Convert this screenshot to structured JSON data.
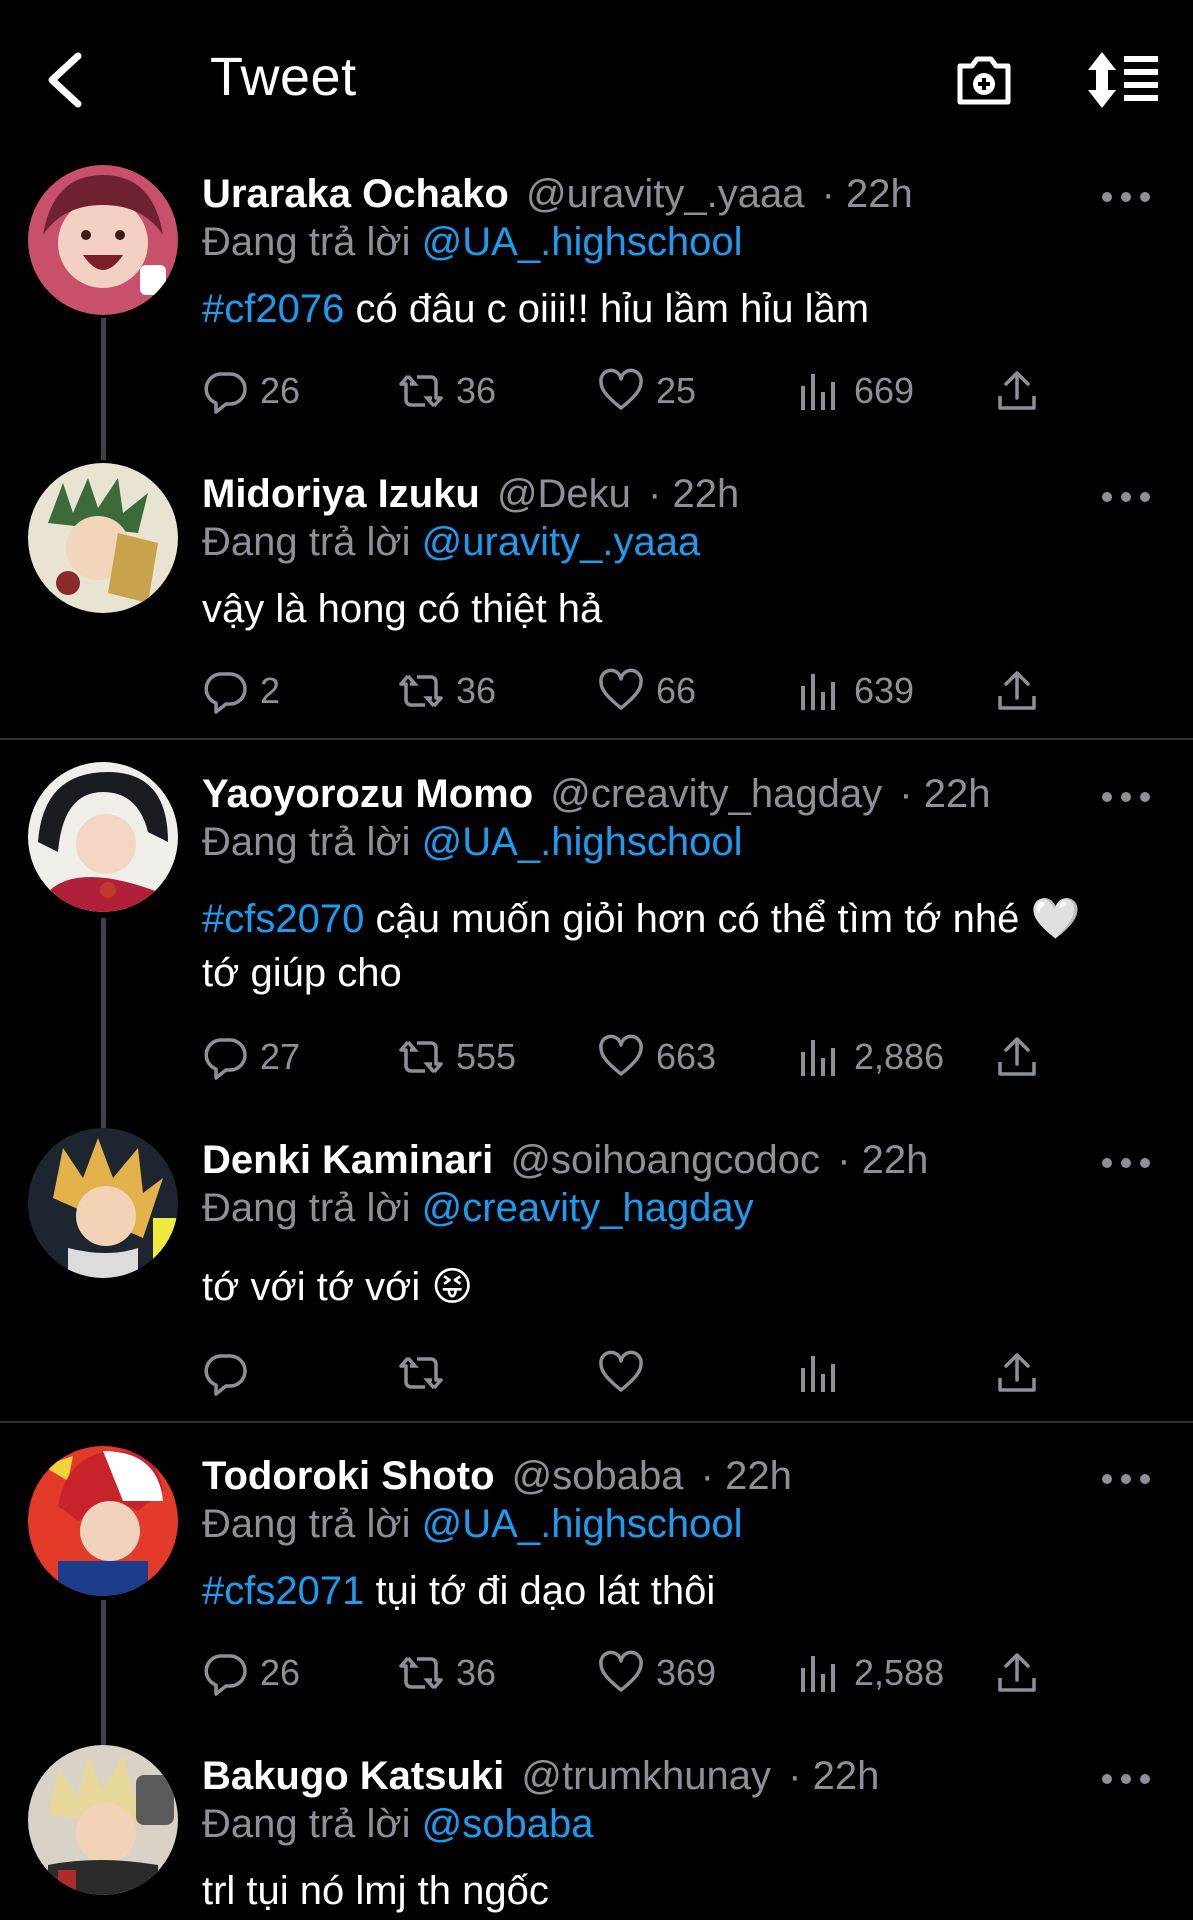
{
  "header": {
    "title": "Tweet"
  },
  "tweets": [
    {
      "name": "Uraraka Ochako",
      "handle": "@uravity_.yaaa",
      "time": "· 22h",
      "reply_prefix": "Đang trả lời",
      "reply_to": "@UA_.highschool",
      "tag": "#cf2076",
      "text": " có đâu c oiii!! hỉu lầm hỉu lầm",
      "replies": "26",
      "retweets": "36",
      "likes": "25",
      "views": "669"
    },
    {
      "name": "Midoriya Izuku",
      "handle": "@Deku",
      "time": "· 22h",
      "reply_prefix": "Đang trả lời",
      "reply_to": "@uravity_.yaaa",
      "tag": "",
      "text": "vậy là hong có thiệt hả",
      "replies": "2",
      "retweets": "36",
      "likes": "66",
      "views": "639"
    },
    {
      "name": "Yaoyorozu Momo",
      "handle": "@creavity_hagday",
      "time": "· 22h",
      "reply_prefix": "Đang trả lời",
      "reply_to": "@UA_.highschool",
      "tag": "#cfs2070",
      "text": " cậu muốn giỏi hơn có thể tìm tớ nhé 🤍",
      "text2": "tớ giúp cho",
      "replies": "27",
      "retweets": "555",
      "likes": "663",
      "views": "2,886"
    },
    {
      "name": "Denki Kaminari",
      "handle": "@soihoangcodoc",
      "time": "· 22h",
      "reply_prefix": "Đang trả lời",
      "reply_to": "@creavity_hagday",
      "tag": "",
      "text": "tớ với tớ với 😝",
      "replies": "",
      "retweets": "",
      "likes": "",
      "views": ""
    },
    {
      "name": "Todoroki Shoto",
      "handle": "@sobaba",
      "time": "· 22h",
      "reply_prefix": "Đang trả lời",
      "reply_to": "@UA_.highschool",
      "tag": "#cfs2071",
      "text": " tụi tớ đi dạo lát thôi",
      "replies": "26",
      "retweets": "36",
      "likes": "369",
      "views": "2,588"
    },
    {
      "name": "Bakugo Katsuki",
      "handle": "@trumkhunay",
      "time": "· 22h",
      "reply_prefix": "Đang trả lời",
      "reply_to": "@sobaba",
      "tag": "",
      "text": "trl tụi nó lmj th ngốc"
    }
  ],
  "colors": {
    "accent": "#1d9bf0",
    "muted": "#8b9197",
    "background": "#000000"
  },
  "icons": [
    "back-arrow-icon",
    "camera-plus-icon",
    "sort-icon",
    "more-icon",
    "reply-icon",
    "retweet-icon",
    "like-icon",
    "views-icon",
    "share-icon"
  ]
}
